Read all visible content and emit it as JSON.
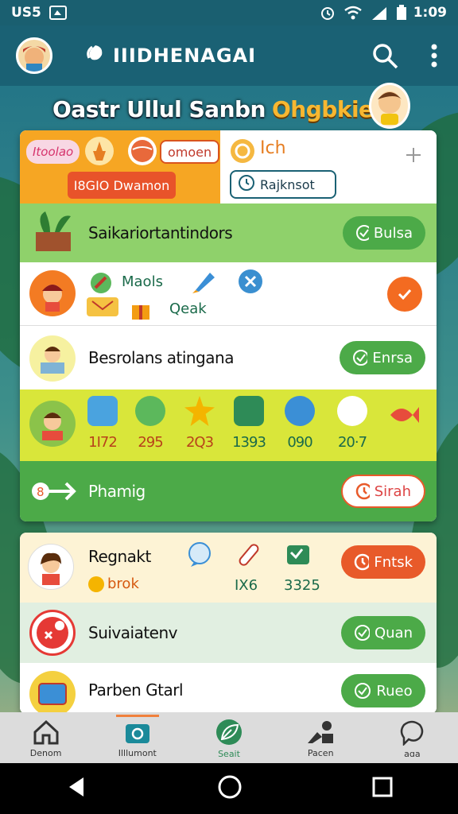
{
  "status_bar": {
    "left_text": "US5",
    "time": "1:09"
  },
  "app_bar": {
    "title": "IIIDHENAGAI"
  },
  "banner": {
    "text_main": "Oastr Ullul Sanbn",
    "text_accent": "Ohgbkie!"
  },
  "card1": {
    "header": {
      "chip1": "Itoolao",
      "chip2": "omoen",
      "orange_button": "I8GIO Dwamon",
      "right_title": "Ich",
      "right_button": "Rajknsot"
    },
    "rows": [
      {
        "label": "Saikariortantindors",
        "action": "Bulsa"
      },
      {
        "label1": "Maols",
        "label2": "Qeak"
      },
      {
        "label": "Besrolans atingana",
        "action": "Enrsa"
      },
      {
        "label": "Phamig",
        "action": "Sirah"
      }
    ],
    "stats": [
      "1I72",
      "295",
      "2Q3",
      "1393",
      "090",
      "20·7"
    ]
  },
  "card2": {
    "rows": [
      {
        "label": "Regnakt",
        "sub": "brok",
        "num1": "IX6",
        "num2": "3325",
        "action": "Fntsk"
      },
      {
        "label": "Suivaiatenv",
        "action": "Quan"
      },
      {
        "label": "Parben Gtarl",
        "action": "Rueo"
      }
    ]
  },
  "nav": [
    {
      "label": "Denom",
      "icon": "home-icon"
    },
    {
      "label": "Illlumont",
      "icon": "camera-icon"
    },
    {
      "label": "Seait",
      "icon": "leaf-icon"
    },
    {
      "label": "Pacen",
      "icon": "tools-icon"
    },
    {
      "label": "aga",
      "icon": "bubble-icon"
    }
  ],
  "colors": {
    "accent_green": "#4caa48",
    "accent_orange": "#e85a2a",
    "app_bar": "#1a6174"
  }
}
